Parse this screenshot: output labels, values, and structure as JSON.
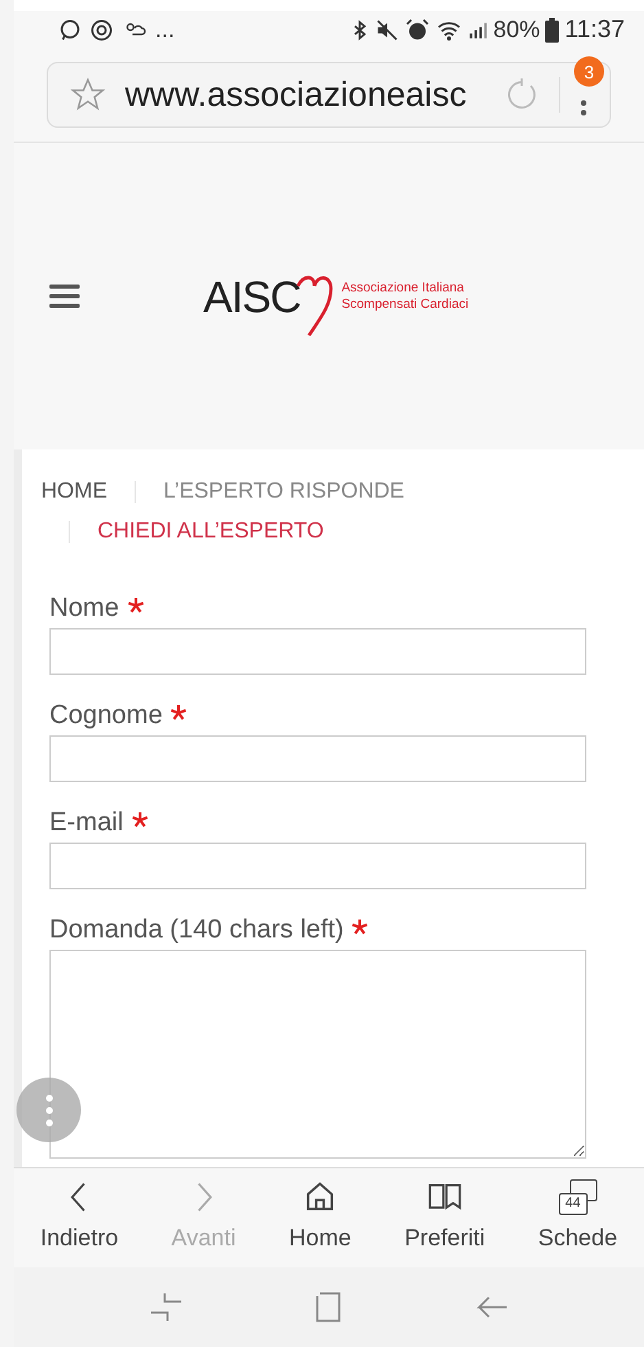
{
  "status_bar": {
    "notifications": "...",
    "battery": "80%",
    "time": "11:37"
  },
  "browser": {
    "url": "www.associazioneaisc",
    "menu_badge": "3"
  },
  "header": {
    "logo_text": "AISC",
    "tagline": [
      "Associazione Italiana",
      "Scompensati Cardiaci"
    ]
  },
  "breadcrumb": [
    {
      "label": "HOME",
      "selected": false
    },
    {
      "label": "L’ESPERTO RISPONDE",
      "selected": false
    },
    {
      "label": "CHIEDI ALL’ESPERTO",
      "selected": true
    }
  ],
  "form": {
    "fields": [
      {
        "label": "Nome",
        "required": true,
        "kind": "input"
      },
      {
        "label": "Cognome",
        "required": true,
        "kind": "input"
      },
      {
        "label": "E-mail",
        "required": true,
        "kind": "input"
      },
      {
        "label": "Domanda (140 chars left)",
        "required": true,
        "kind": "textarea"
      }
    ]
  },
  "bottom_nav": [
    {
      "label": "Indietro",
      "disabled": false,
      "kind": "back"
    },
    {
      "label": "Avanti",
      "disabled": true,
      "kind": "forward"
    },
    {
      "label": "Home",
      "disabled": false,
      "kind": "home"
    },
    {
      "label": "Preferiti",
      "disabled": false,
      "kind": "bookmarks"
    },
    {
      "label": "Schede",
      "disabled": false,
      "kind": "tabs",
      "count": "44"
    }
  ]
}
